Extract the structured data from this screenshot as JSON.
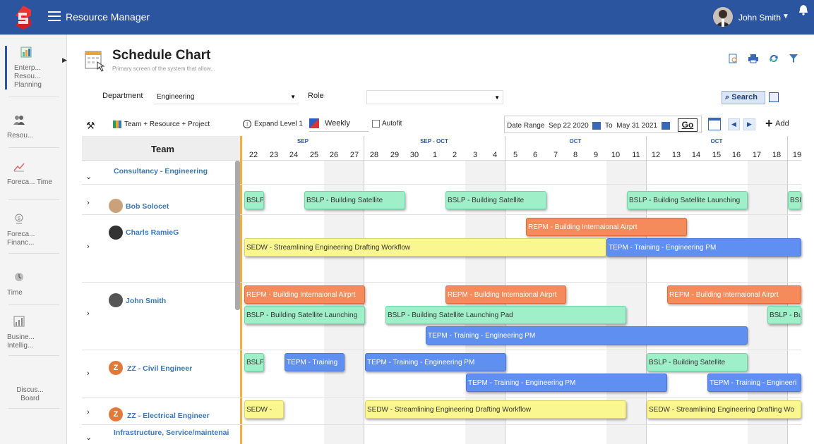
{
  "app": {
    "title": "Resource Manager",
    "user_name": "John Smith"
  },
  "sidebar": {
    "items": [
      {
        "label": "Enterp... Resou... Planning",
        "icon": "enterprise-planning-icon"
      },
      {
        "label": "Resou...",
        "icon": "resources-icon"
      },
      {
        "label": "Foreca... Time",
        "icon": "forecast-time-icon"
      },
      {
        "label": "Foreca... Financ...",
        "icon": "forecast-finance-icon"
      },
      {
        "label": "Time",
        "icon": "time-icon"
      },
      {
        "label": "Busine... Intellig...",
        "icon": "business-intelligence-icon"
      },
      {
        "label": "Discus... Board",
        "icon": "discussion-board-icon"
      }
    ]
  },
  "header": {
    "title": "Schedule Chart",
    "subtitle": "Primary screen of the system that allow..."
  },
  "filters": {
    "department_label": "Department",
    "department_value": "Engineering",
    "role_label": "Role",
    "role_value": "",
    "search_label": "Search"
  },
  "toolbar": {
    "view_label": "Team + Resource + Project",
    "expand_label": "Expand Level 1",
    "period_label": "Weekly",
    "autofit_label": "Autofit",
    "date_range_label": "Date Range",
    "date_from": "Sep 22 2020",
    "to_label": "To",
    "date_to": "May 31 2021",
    "go_label": "Go",
    "add_label": "Add"
  },
  "grid": {
    "team_header": "Team",
    "months": [
      "SEP",
      "SEP - OCT",
      "OCT",
      "OCT"
    ],
    "days": [
      "22",
      "23",
      "24",
      "25",
      "26",
      "27",
      "28",
      "29",
      "30",
      "1",
      "2",
      "3",
      "4",
      "5",
      "6",
      "7",
      "8",
      "9",
      "10",
      "11",
      "12",
      "13",
      "14",
      "15",
      "16",
      "17",
      "18",
      "19"
    ],
    "rows": {
      "group1": "Consultancy - Engineering",
      "bob": "Bob Solocet",
      "charls": "Charls RamieG",
      "john": "John Smith",
      "civil": "ZZ - Civil Engineer",
      "electrical": "ZZ - Electrical Engineer",
      "group2": "Infrastructure, Service/maintenai",
      "z_initial": "Z"
    }
  },
  "bars": [
    "BSLP",
    "BSLP - Building Satellite",
    "BSLP - Building Satellite",
    "BSLP - Building Satellite Launching",
    "BSL",
    "REPM - Building Internaional Airprt",
    "SEDW - Streamlining Engineering Drafting Workflow",
    "TEPM - Training - Engineering PM",
    "REPM - Building Internaional Airprt",
    "REPM - Building Internaional Airprt",
    "REPM - Building Internaional Airprt",
    "BSLP - Building Satellite Launching",
    "BSLP - Building Satellite Launching Pad",
    "BSLP - Bu",
    "TEPM - Training - Engineering PM",
    "BSLP",
    "TEPM - Training",
    "TEPM - Training - Engineering PM",
    "BSLP - Building Satellite",
    "TEPM - Training - Engineering PM",
    "TEPM - Training - Engineeri",
    "SEDW -",
    "SEDW - Streamlining Engineering Drafting Workflow",
    "SEDW - Streamlining Engineering Drafting Wo"
  ],
  "colors": {
    "topbar": "#2c55a0",
    "green": "#9ff0c8",
    "orange": "#f58a5a",
    "yellow": "#fbf790",
    "blue": "#5f8ff0"
  }
}
